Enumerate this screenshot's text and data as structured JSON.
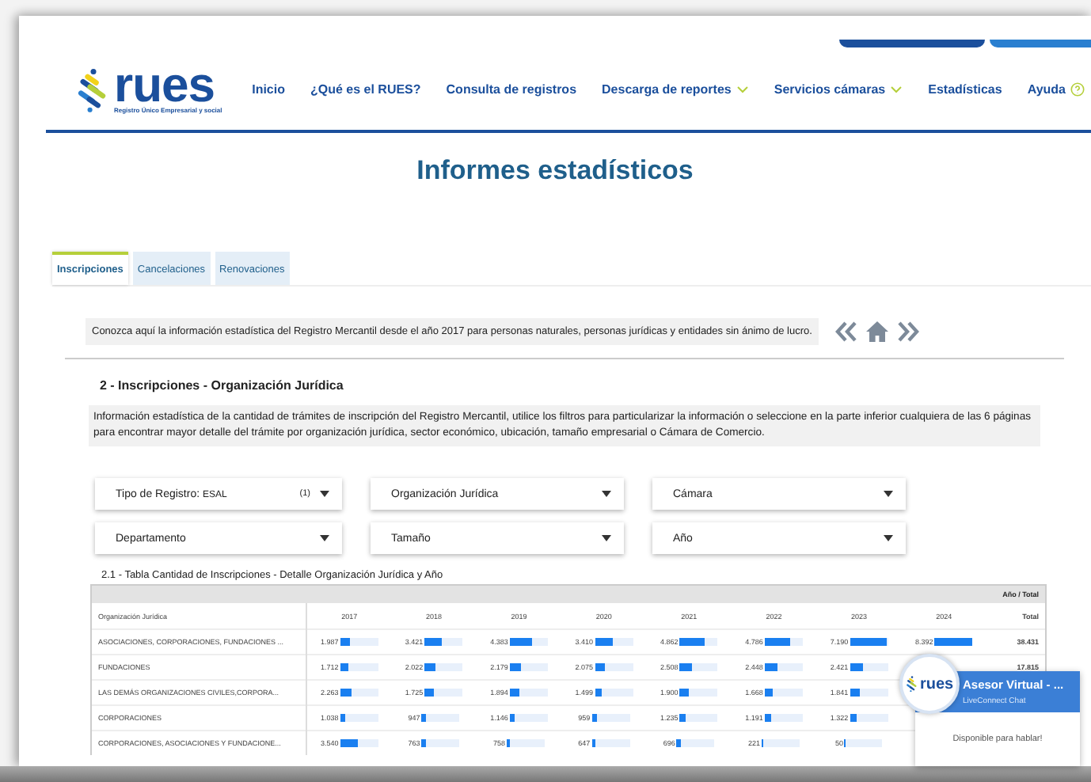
{
  "header": {
    "logo": {
      "name": "rues",
      "tagline": "Registro Único Empresarial y social"
    },
    "nav": [
      {
        "label": "Inicio",
        "dropdown": false
      },
      {
        "label": "¿Qué es el RUES?",
        "dropdown": false
      },
      {
        "label": "Consulta de registros",
        "dropdown": false
      },
      {
        "label": "Descarga de reportes",
        "dropdown": true
      },
      {
        "label": "Servicios cámaras",
        "dropdown": true
      },
      {
        "label": "Estadísticas",
        "dropdown": false
      },
      {
        "label": "Ayuda",
        "dropdown": false,
        "help": true
      }
    ]
  },
  "page_title": "Informes estadísticos",
  "tabs": [
    {
      "label": "Inscripciones",
      "selected": true
    },
    {
      "label": "Cancelaciones",
      "selected": false
    },
    {
      "label": "Renovaciones",
      "selected": false
    }
  ],
  "intro": "Conozca aquí la información estadística del Registro Mercantil desde el año 2017 para personas naturales, personas jurídicas y entidades sin ánimo de lucro.",
  "section_title": "2 - Inscripciones - Organización Jurídica",
  "description": "Información estadística de la cantidad de trámites de inscripción del Registro Mercantil, utilice los filtros para particularizar la información o seleccione en la parte inferior cualquiera de las 6 páginas para encontrar mayor detalle del trámite por organización jurídica, sector económico, ubicación, tamaño empresarial o Cámara de Comercio.",
  "filters": [
    {
      "label": "Tipo de Registro:",
      "value": "ESAL",
      "count": "(1)"
    },
    {
      "label": "Organización Jurídica"
    },
    {
      "label": "Cámara"
    },
    {
      "label": "Departamento"
    },
    {
      "label": "Tamaño"
    },
    {
      "label": "Año"
    }
  ],
  "table": {
    "title": "2.1 - Tabla Cantidad de Inscripciones - Detalle Organización Jurídica y Año",
    "band_label": "Año / Total",
    "row_header": "Organización Jurídica",
    "columns": [
      "2017",
      "2018",
      "2019",
      "2020",
      "2021",
      "2022",
      "2023",
      "2024",
      "Total"
    ],
    "rows": [
      {
        "name": "ASOCIACIONES, CORPORACIONES, FUNDACIONES ...",
        "cells": [
          {
            "value": "1.987",
            "level": 0.27
          },
          {
            "value": "3.421",
            "level": 0.46
          },
          {
            "value": "4.383",
            "level": 0.59
          },
          {
            "value": "3.410",
            "level": 0.46
          },
          {
            "value": "4.862",
            "level": 0.66
          },
          {
            "value": "4.786",
            "level": 0.65
          },
          {
            "value": "7.190",
            "level": 0.97
          },
          {
            "value": "8.392",
            "level": 1.0
          }
        ],
        "total": "38.431"
      },
      {
        "name": "FUNDACIONES",
        "cells": [
          {
            "value": "1.712",
            "level": 0.23
          },
          {
            "value": "2.022",
            "level": 0.27
          },
          {
            "value": "2.179",
            "level": 0.29
          },
          {
            "value": "2.075",
            "level": 0.28
          },
          {
            "value": "2.508",
            "level": 0.34
          },
          {
            "value": "2.448",
            "level": 0.33
          },
          {
            "value": "2.421",
            "level": 0.33
          }
        ],
        "total": "17.815"
      },
      {
        "name": "LAS DEMÁS ORGANIZACIONES CIVILES,CORPORA...",
        "cells": [
          {
            "value": "2.263",
            "level": 0.3
          },
          {
            "value": "1.725",
            "level": 0.23
          },
          {
            "value": "1.894",
            "level": 0.25
          },
          {
            "value": "1.499",
            "level": 0.2
          },
          {
            "value": "1.900",
            "level": 0.26
          },
          {
            "value": "1.668",
            "level": 0.22
          },
          {
            "value": "1.841",
            "level": 0.25
          }
        ]
      },
      {
        "name": "CORPORACIONES",
        "cells": [
          {
            "value": "1.038",
            "level": 0.14
          },
          {
            "value": "947",
            "level": 0.13
          },
          {
            "value": "1.146",
            "level": 0.15
          },
          {
            "value": "959",
            "level": 0.13
          },
          {
            "value": "1.235",
            "level": 0.17
          },
          {
            "value": "1.191",
            "level": 0.16
          },
          {
            "value": "1.322",
            "level": 0.18
          }
        ]
      },
      {
        "name": "CORPORACIONES, ASOCIACIONES Y FUNDACIONE...",
        "cells": [
          {
            "value": "3.540",
            "level": 0.48
          },
          {
            "value": "763",
            "level": 0.1
          },
          {
            "value": "758",
            "level": 0.1
          },
          {
            "value": "647",
            "level": 0.09
          },
          {
            "value": "696",
            "level": 0.09
          },
          {
            "value": "221",
            "level": 0.03
          },
          {
            "value": "50",
            "level": 0.01
          }
        ]
      }
    ]
  },
  "chat": {
    "logo": "rues",
    "title": "Asesor Virtual - ...",
    "subtitle": "LiveConnect Chat",
    "status": "Disponible para hablar!"
  }
}
